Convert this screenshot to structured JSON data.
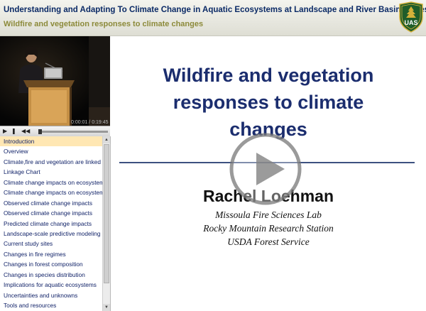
{
  "header": {
    "main_title": "Understanding and Adapting To Climate Change in Aquatic Ecosystems at Landscape and River Basin Scales",
    "sub_title": "Wildfire and vegetation responses to climate changes",
    "logo_text": "UAS"
  },
  "player": {
    "time_display": "0:00:01 / 0:19:45",
    "progress_fraction": 0.0,
    "controls": [
      "play-icon",
      "pause-icon",
      "rewind-icon"
    ]
  },
  "chapters": {
    "active_index": 0,
    "items": [
      "Introduction",
      "Overview",
      "Climate,fire and vegetation are linked",
      "Linkage Chart",
      "Climate change impacts on ecosystem",
      "Climate change impacts on ecosystem",
      "Observed climate change impacts",
      "Observed climate change impacts",
      "Predicted climate change impacts",
      "Landscape-scale predictive modeling",
      "Current study sites",
      "Changes in fire regimes",
      "Changes in forest composition",
      "Changes in species distribution",
      "Implications for aquatic ecosystems",
      "Uncertainties and unknowns",
      "Tools and resources"
    ]
  },
  "slide": {
    "title_lines": [
      "Wildfire and vegetation",
      "responses to climate",
      "changes"
    ],
    "presenter": "Rachel Loehman",
    "affiliations": [
      "Missoula Fire Sciences Lab",
      "Rocky Mountain Research Station",
      "USDA Forest Service"
    ]
  },
  "colors": {
    "title_blue": "#1b2d6e",
    "header_title": "#0b2a66",
    "header_sub": "#8c8a3a",
    "active_chapter": "#ffe7b3",
    "shield_green": "#1f5d2a",
    "shield_gold": "#d4b13a"
  }
}
